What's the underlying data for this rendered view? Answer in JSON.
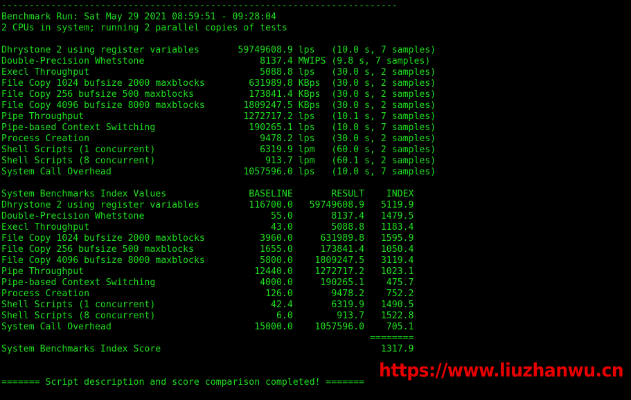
{
  "terminal": {
    "title": "UnixBench benchmark results",
    "foreground_color": "#1ee01e",
    "background_color": "#000000",
    "watermark_color": "#e80000",
    "top_rule": "------------------------------------------------------------------------",
    "header": {
      "benchmark_run": "Benchmark Run: Sat May 29 2021 08:59:51 - 09:28:04",
      "cpu_line": "2 CPUs in system; running 2 parallel copies of tests"
    },
    "raw_results": {
      "rows": [
        {
          "name": "Dhrystone 2 using register variables",
          "value": "59749608.9",
          "unit": "lps",
          "samples": "(10.0 s, 7 samples)"
        },
        {
          "name": "Double-Precision Whetstone",
          "value": "8137.4",
          "unit": "MWIPS",
          "samples": "(9.8 s, 7 samples)"
        },
        {
          "name": "Execl Throughput",
          "value": "5088.8",
          "unit": "lps",
          "samples": "(30.0 s, 2 samples)"
        },
        {
          "name": "File Copy 1024 bufsize 2000 maxblocks",
          "value": "631989.8",
          "unit": "KBps",
          "samples": "(30.0 s, 2 samples)"
        },
        {
          "name": "File Copy 256 bufsize 500 maxblocks",
          "value": "173841.4",
          "unit": "KBps",
          "samples": "(30.0 s, 2 samples)"
        },
        {
          "name": "File Copy 4096 bufsize 8000 maxblocks",
          "value": "1809247.5",
          "unit": "KBps",
          "samples": "(30.0 s, 2 samples)"
        },
        {
          "name": "Pipe Throughput",
          "value": "1272717.2",
          "unit": "lps",
          "samples": "(10.1 s, 7 samples)"
        },
        {
          "name": "Pipe-based Context Switching",
          "value": "190265.1",
          "unit": "lps",
          "samples": "(10.0 s, 7 samples)"
        },
        {
          "name": "Process Creation",
          "value": "9478.2",
          "unit": "lps",
          "samples": "(30.0 s, 2 samples)"
        },
        {
          "name": "Shell Scripts (1 concurrent)",
          "value": "6319.9",
          "unit": "lpm",
          "samples": "(60.0 s, 2 samples)"
        },
        {
          "name": "Shell Scripts (8 concurrent)",
          "value": "913.7",
          "unit": "lpm",
          "samples": "(60.1 s, 2 samples)"
        },
        {
          "name": "System Call Overhead",
          "value": "1057596.0",
          "unit": "lps",
          "samples": "(10.0 s, 7 samples)"
        }
      ]
    },
    "index_table": {
      "title": "System Benchmarks Index Values",
      "columns": [
        "BASELINE",
        "RESULT",
        "INDEX"
      ],
      "rows": [
        {
          "name": "Dhrystone 2 using register variables",
          "baseline": "116700.0",
          "result": "59749608.9",
          "index": "5119.9"
        },
        {
          "name": "Double-Precision Whetstone",
          "baseline": "55.0",
          "result": "8137.4",
          "index": "1479.5"
        },
        {
          "name": "Execl Throughput",
          "baseline": "43.0",
          "result": "5088.8",
          "index": "1183.4"
        },
        {
          "name": "File Copy 1024 bufsize 2000 maxblocks",
          "baseline": "3960.0",
          "result": "631989.8",
          "index": "1595.9"
        },
        {
          "name": "File Copy 256 bufsize 500 maxblocks",
          "baseline": "1655.0",
          "result": "173841.4",
          "index": "1050.4"
        },
        {
          "name": "File Copy 4096 bufsize 8000 maxblocks",
          "baseline": "5800.0",
          "result": "1809247.5",
          "index": "3119.4"
        },
        {
          "name": "Pipe Throughput",
          "baseline": "12440.0",
          "result": "1272717.2",
          "index": "1023.1"
        },
        {
          "name": "Pipe-based Context Switching",
          "baseline": "4000.0",
          "result": "190265.1",
          "index": "475.7"
        },
        {
          "name": "Process Creation",
          "baseline": "126.0",
          "result": "9478.2",
          "index": "752.2"
        },
        {
          "name": "Shell Scripts (1 concurrent)",
          "baseline": "42.4",
          "result": "6319.9",
          "index": "1490.5"
        },
        {
          "name": "Shell Scripts (8 concurrent)",
          "baseline": "6.0",
          "result": "913.7",
          "index": "1522.8"
        },
        {
          "name": "System Call Overhead",
          "baseline": "15000.0",
          "result": "1057596.0",
          "index": "705.1"
        }
      ],
      "separator": "========",
      "score_label": "System Benchmarks Index Score",
      "score_value": "1317.9"
    },
    "watermark": "https://www.liuzhanwu.cn",
    "footer": "======= Script description and score comparison completed! ======="
  },
  "screen_text": "------------------------------------------------------------------------\nBenchmark Run: Sat May 29 2021 08:59:51 - 09:28:04\n2 CPUs in system; running 2 parallel copies of tests\n\nDhrystone 2 using register variables       59749608.9 lps   (10.0 s, 7 samples)\nDouble-Precision Whetstone                     8137.4 MWIPS (9.8 s, 7 samples)\nExecl Throughput                               5088.8 lps   (30.0 s, 2 samples)\nFile Copy 1024 bufsize 2000 maxblocks        631989.8 KBps  (30.0 s, 2 samples)\nFile Copy 256 bufsize 500 maxblocks          173841.4 KBps  (30.0 s, 2 samples)\nFile Copy 4096 bufsize 8000 maxblocks       1809247.5 KBps  (30.0 s, 2 samples)\nPipe Throughput                             1272717.2 lps   (10.1 s, 7 samples)\nPipe-based Context Switching                 190265.1 lps   (10.0 s, 7 samples)\nProcess Creation                               9478.2 lps   (30.0 s, 2 samples)\nShell Scripts (1 concurrent)                   6319.9 lpm   (60.0 s, 2 samples)\nShell Scripts (8 concurrent)                    913.7 lpm   (60.1 s, 2 samples)\nSystem Call Overhead                        1057596.0 lps   (10.0 s, 7 samples)\n\nSystem Benchmarks Index Values               BASELINE       RESULT    INDEX\nDhrystone 2 using register variables         116700.0   59749608.9   5119.9\nDouble-Precision Whetstone                       55.0       8137.4   1479.5\nExecl Throughput                                 43.0       5088.8   1183.4\nFile Copy 1024 bufsize 2000 maxblocks          3960.0     631989.8   1595.9\nFile Copy 256 bufsize 500 maxblocks            1655.0     173841.4   1050.4\nFile Copy 4096 bufsize 8000 maxblocks          5800.0    1809247.5   3119.4\nPipe Throughput                               12440.0    1272717.2   1023.1\nPipe-based Context Switching                   4000.0     190265.1    475.7\nProcess Creation                                126.0       9478.2    752.2\nShell Scripts (1 concurrent)                     42.4       6319.9   1490.5\nShell Scripts (8 concurrent)                      6.0        913.7   1522.8\nSystem Call Overhead                          15000.0    1057596.0    705.1\n                                                                   ========\nSystem Benchmarks Index Score                                        1317.9\n\n\n======= Script description and score comparison completed! ======="
}
